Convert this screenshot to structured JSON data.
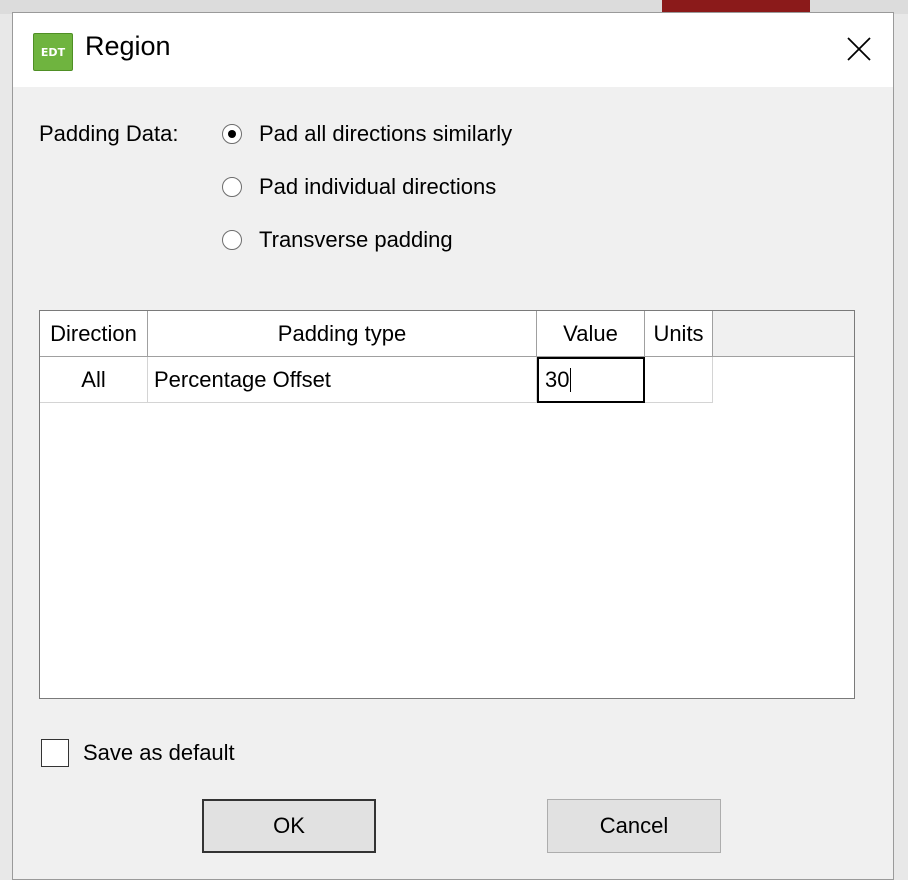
{
  "window": {
    "title": "Region",
    "icon_label": "EDT",
    "icon_name": "edt-app-icon",
    "close_icon": "close-icon"
  },
  "padding": {
    "label": "Padding Data:",
    "options": [
      {
        "label": "Pad all directions similarly",
        "checked": true
      },
      {
        "label": "Pad individual directions",
        "checked": false
      },
      {
        "label": "Transverse padding",
        "checked": false
      }
    ]
  },
  "table": {
    "headers": [
      "Direction",
      "Padding type",
      "Value",
      "Units"
    ],
    "rows": [
      {
        "direction": "All",
        "padding_type": "Percentage Offset",
        "value": "30",
        "units": ""
      }
    ]
  },
  "save_default": {
    "label": "Save as default",
    "checked": false
  },
  "buttons": {
    "ok": "OK",
    "cancel": "Cancel"
  },
  "colors": {
    "window_bg": "#f0f0f0",
    "titlebar_bg": "#ffffff",
    "icon_green": "#6fb43f",
    "backdrop_red": "#8b1a1a"
  }
}
